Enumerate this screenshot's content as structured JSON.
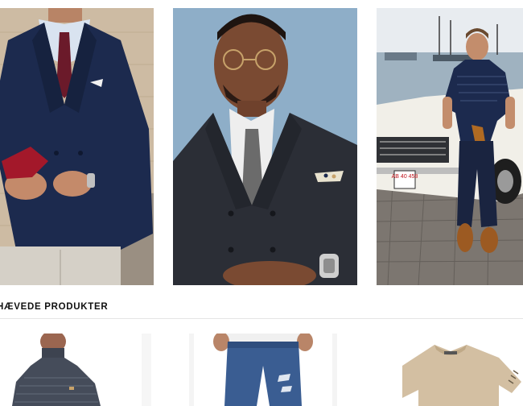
{
  "sections": {
    "featured_title": "HÆVEDE PRODUKTER"
  },
  "hero_images": [
    {
      "subject": "man-navy-double-breasted-blazer-holding-red-gloves"
    },
    {
      "subject": "man-black-suit-glasses-grey-knit-tie"
    },
    {
      "subject": "man-navy-tshirt-leaning-on-white-car"
    }
  ],
  "car_plate": "AB 40 458",
  "products": [
    {
      "subject": "dark-grey-turtleneck-sweater"
    },
    {
      "subject": "ripped-blue-jeans"
    },
    {
      "subject": "beige-tshirt"
    }
  ],
  "colors": {
    "navy": "#1c2a4e",
    "backdrop_blue": "#8eaec8",
    "brick": "#c9b59c",
    "beige": "#d3bfa2"
  }
}
